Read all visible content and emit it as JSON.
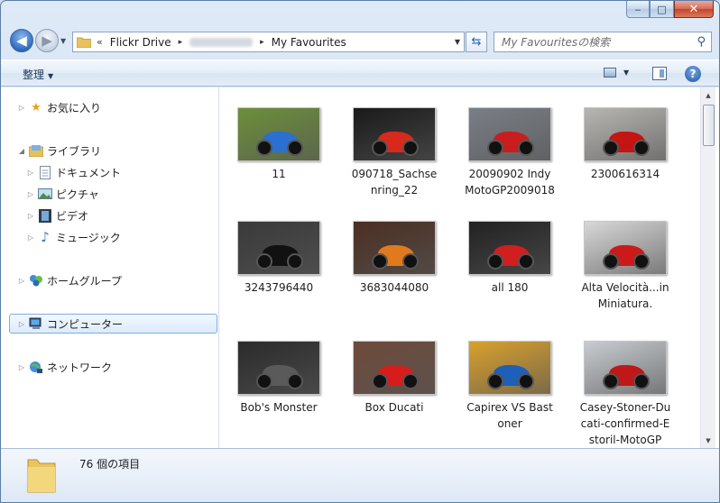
{
  "window": {
    "caption": {
      "minimize": "‒",
      "maximize": "□",
      "close": "✕"
    }
  },
  "nav": {
    "back_icon": "arrow-left-icon",
    "forward_icon": "arrow-right-icon"
  },
  "address": {
    "chevrons": "«",
    "root": "Flickr Drive",
    "current": "My Favourites",
    "separator": "▸"
  },
  "search": {
    "placeholder": "My Favouritesの検索"
  },
  "commandbar": {
    "organize": "整理",
    "help": "?"
  },
  "sidebar": {
    "favorites": "お気に入り",
    "libraries": "ライブラリ",
    "documents": "ドキュメント",
    "pictures": "ピクチャ",
    "videos": "ビデオ",
    "music": "ミュージック",
    "homegroup": "ホームグループ",
    "computer": "コンピューター",
    "network": "ネットワーク"
  },
  "files": [
    {
      "label": "11",
      "bg": "#6c8f3a",
      "accent": "#2b6fd1"
    },
    {
      "label": "090718_Sachsenring_22",
      "bg": "#1a1a1a",
      "accent": "#d72a1c"
    },
    {
      "label": "20090902 Indy MotoGP2009018",
      "bg": "#7a7f86",
      "accent": "#c81e1e"
    },
    {
      "label": "2300616314",
      "bg": "#b8b6b2",
      "accent": "#c41414"
    },
    {
      "label": "3243796440",
      "bg": "#3b3a3a",
      "accent": "#111111"
    },
    {
      "label": "3683044080",
      "bg": "#4b2f22",
      "accent": "#e07a1c"
    },
    {
      "label": "all 180",
      "bg": "#222222",
      "accent": "#d11e1e"
    },
    {
      "label": "Alta Velocità...in Miniatura.",
      "bg": "#d8d8d8",
      "accent": "#cc1a1a"
    },
    {
      "label": "Bob's Monster",
      "bg": "#2b2b2b",
      "accent": "#5a5a5a"
    },
    {
      "label": "Box Ducati",
      "bg": "#6e4a3a",
      "accent": "#d81c1c"
    },
    {
      "label": "Capirex VS Bastoner",
      "bg": "#d9a02c",
      "accent": "#1e5fb8"
    },
    {
      "label": "Casey-Stoner-Ducati-confirmed-Estoril-MotoGP",
      "bg": "#c8ccd0",
      "accent": "#c01818"
    }
  ],
  "details": {
    "count": "76 個の項目"
  }
}
